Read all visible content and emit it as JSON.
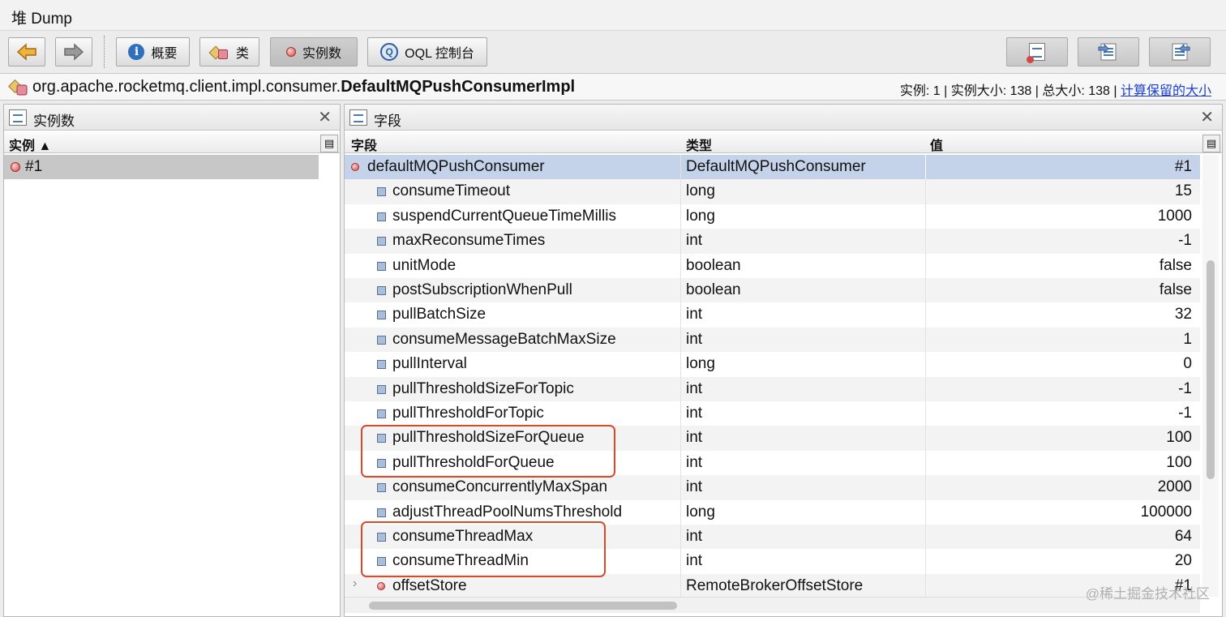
{
  "window": {
    "title": "堆 Dump"
  },
  "toolbar": {
    "back_icon": "arrow-left-icon",
    "forward_icon": "arrow-right-icon",
    "summary_label": "概要",
    "classes_label": "类",
    "instances_label": "实例数",
    "oql_label": "OQL 控制台",
    "oql_icon_text": "Q"
  },
  "classbar": {
    "package": "org.apache.rocketmq.client.impl.consumer.",
    "classname": "DefaultMQPushConsumerImpl",
    "stats": "实例: 1 | 实例大小: 138 | 总大小: 138 |",
    "retained_link": "计算保留的大小"
  },
  "left_panel": {
    "title": "实例数",
    "column": "实例 ▲",
    "instances": [
      "#1"
    ]
  },
  "right_panel": {
    "title": "字段",
    "columns": {
      "field": "字段",
      "type": "类型",
      "value": "值"
    },
    "rows": [
      {
        "field": "defaultMQPushConsumer",
        "type": "DefaultMQPushConsumer",
        "value": "#1"
      },
      {
        "field": "consumeTimeout",
        "type": "long",
        "value": "15"
      },
      {
        "field": "suspendCurrentQueueTimeMillis",
        "type": "long",
        "value": "1000"
      },
      {
        "field": "maxReconsumeTimes",
        "type": "int",
        "value": "-1"
      },
      {
        "field": "unitMode",
        "type": "boolean",
        "value": "false"
      },
      {
        "field": "postSubscriptionWhenPull",
        "type": "boolean",
        "value": "false"
      },
      {
        "field": "pullBatchSize",
        "type": "int",
        "value": "32"
      },
      {
        "field": "consumeMessageBatchMaxSize",
        "type": "int",
        "value": "1"
      },
      {
        "field": "pullInterval",
        "type": "long",
        "value": "0"
      },
      {
        "field": "pullThresholdSizeForTopic",
        "type": "int",
        "value": "-1"
      },
      {
        "field": "pullThresholdForTopic",
        "type": "int",
        "value": "-1"
      },
      {
        "field": "pullThresholdSizeForQueue",
        "type": "int",
        "value": "100"
      },
      {
        "field": "pullThresholdForQueue",
        "type": "int",
        "value": "100"
      },
      {
        "field": "consumeConcurrentlyMaxSpan",
        "type": "int",
        "value": "2000"
      },
      {
        "field": "adjustThreadPoolNumsThreshold",
        "type": "long",
        "value": "100000"
      },
      {
        "field": "consumeThreadMax",
        "type": "int",
        "value": "64"
      },
      {
        "field": "consumeThreadMin",
        "type": "int",
        "value": "20"
      },
      {
        "field": "offsetStore",
        "type": "RemoteBrokerOffsetStore",
        "value": "#1"
      }
    ]
  },
  "watermark": "@稀土掘金技术社区",
  "highlight_color": "#d84a2a"
}
